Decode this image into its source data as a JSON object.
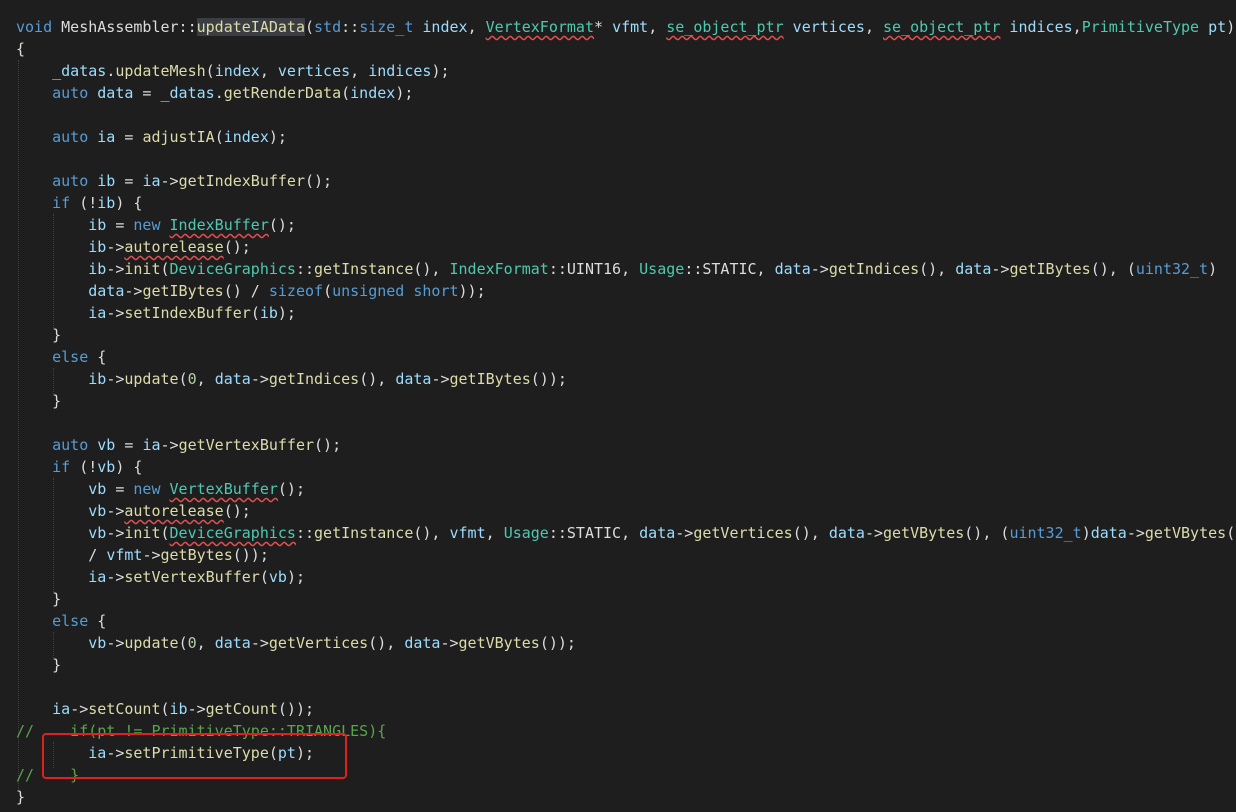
{
  "editor": {
    "highlighted_line": "ia->setPrimitiveType(pt);"
  },
  "lines": [
    [
      [
        "kw",
        "void "
      ],
      [
        "pl",
        "MeshAssembler::"
      ],
      [
        "fn sel",
        "updateIAData"
      ],
      [
        "pl",
        "("
      ],
      [
        "kw",
        "std"
      ],
      [
        "pl",
        "::"
      ],
      [
        "kw",
        "size_t "
      ],
      [
        "var",
        "index"
      ],
      [
        "pl",
        ", "
      ],
      [
        "cls err",
        "VertexFormat"
      ],
      [
        "pl",
        "* "
      ],
      [
        "var",
        "vfmt"
      ],
      [
        "pl",
        ", "
      ],
      [
        "cls err",
        "se_object_ptr"
      ],
      [
        "var",
        " vertices"
      ],
      [
        "pl",
        ", "
      ],
      [
        "cls err",
        "se_object_ptr"
      ],
      [
        "var",
        " indices"
      ],
      [
        "pl",
        ","
      ],
      [
        "cls",
        "PrimitiveType"
      ],
      [
        "var",
        " pt"
      ],
      [
        "pl",
        ")"
      ]
    ],
    [
      [
        "pl",
        "{"
      ]
    ],
    [
      [
        "pl",
        "    "
      ],
      [
        "var",
        "_datas"
      ],
      [
        "pl",
        "."
      ],
      [
        "fn",
        "updateMesh"
      ],
      [
        "pl",
        "("
      ],
      [
        "var",
        "index"
      ],
      [
        "pl",
        ", "
      ],
      [
        "var",
        "vertices"
      ],
      [
        "pl",
        ", "
      ],
      [
        "var",
        "indices"
      ],
      [
        "pl",
        ");"
      ]
    ],
    [
      [
        "pl",
        "    "
      ],
      [
        "kw",
        "auto "
      ],
      [
        "var",
        "data"
      ],
      [
        "pl",
        " = "
      ],
      [
        "var",
        "_datas"
      ],
      [
        "pl",
        "."
      ],
      [
        "fn",
        "getRenderData"
      ],
      [
        "pl",
        "("
      ],
      [
        "var",
        "index"
      ],
      [
        "pl",
        ");"
      ]
    ],
    [],
    [
      [
        "pl",
        "    "
      ],
      [
        "kw",
        "auto "
      ],
      [
        "var",
        "ia"
      ],
      [
        "pl",
        " = "
      ],
      [
        "fn",
        "adjustIA"
      ],
      [
        "pl",
        "("
      ],
      [
        "var",
        "index"
      ],
      [
        "pl",
        ");"
      ]
    ],
    [],
    [
      [
        "pl",
        "    "
      ],
      [
        "kw",
        "auto "
      ],
      [
        "var",
        "ib"
      ],
      [
        "pl",
        " = "
      ],
      [
        "var",
        "ia"
      ],
      [
        "pl",
        "->"
      ],
      [
        "fn",
        "getIndexBuffer"
      ],
      [
        "pl",
        "();"
      ]
    ],
    [
      [
        "pl",
        "    "
      ],
      [
        "kw",
        "if "
      ],
      [
        "pl",
        "(!"
      ],
      [
        "var",
        "ib"
      ],
      [
        "pl",
        ") {"
      ]
    ],
    [
      [
        "pl",
        "        "
      ],
      [
        "var",
        "ib"
      ],
      [
        "pl",
        " = "
      ],
      [
        "kw",
        "new "
      ],
      [
        "cls err",
        "IndexBuffer"
      ],
      [
        "pl",
        "();"
      ]
    ],
    [
      [
        "pl",
        "        "
      ],
      [
        "var",
        "ib"
      ],
      [
        "pl",
        "->"
      ],
      [
        "fn err",
        "autorelease"
      ],
      [
        "pl",
        "();"
      ]
    ],
    [
      [
        "pl",
        "        "
      ],
      [
        "var",
        "ib"
      ],
      [
        "pl",
        "->"
      ],
      [
        "fn",
        "init"
      ],
      [
        "pl",
        "("
      ],
      [
        "cls",
        "DeviceGraphics"
      ],
      [
        "pl",
        "::"
      ],
      [
        "fn",
        "getInstance"
      ],
      [
        "pl",
        "(), "
      ],
      [
        "cls",
        "IndexFormat"
      ],
      [
        "pl",
        "::UINT16, "
      ],
      [
        "cls",
        "Usage"
      ],
      [
        "pl",
        "::STATIC, "
      ],
      [
        "var",
        "data"
      ],
      [
        "pl",
        "->"
      ],
      [
        "fn",
        "getIndices"
      ],
      [
        "pl",
        "(), "
      ],
      [
        "var",
        "data"
      ],
      [
        "pl",
        "->"
      ],
      [
        "fn",
        "getIBytes"
      ],
      [
        "pl",
        "(), ("
      ],
      [
        "kw",
        "uint32_t"
      ],
      [
        "pl",
        ")"
      ]
    ],
    [
      [
        "pl",
        "        "
      ],
      [
        "var",
        "data"
      ],
      [
        "pl",
        "->"
      ],
      [
        "fn",
        "getIBytes"
      ],
      [
        "pl",
        "() / "
      ],
      [
        "kw",
        "sizeof"
      ],
      [
        "pl",
        "("
      ],
      [
        "kw",
        "unsigned short"
      ],
      [
        "pl",
        "));"
      ]
    ],
    [
      [
        "pl",
        "        "
      ],
      [
        "var",
        "ia"
      ],
      [
        "pl",
        "->"
      ],
      [
        "fn",
        "setIndexBuffer"
      ],
      [
        "pl",
        "("
      ],
      [
        "var",
        "ib"
      ],
      [
        "pl",
        ");"
      ]
    ],
    [
      [
        "pl",
        "    }"
      ]
    ],
    [
      [
        "pl",
        "    "
      ],
      [
        "kw",
        "else "
      ],
      [
        "pl",
        "{"
      ]
    ],
    [
      [
        "pl",
        "        "
      ],
      [
        "var",
        "ib"
      ],
      [
        "pl",
        "->"
      ],
      [
        "fn",
        "update"
      ],
      [
        "pl",
        "("
      ],
      [
        "num",
        "0"
      ],
      [
        "pl",
        ", "
      ],
      [
        "var",
        "data"
      ],
      [
        "pl",
        "->"
      ],
      [
        "fn",
        "getIndices"
      ],
      [
        "pl",
        "(), "
      ],
      [
        "var",
        "data"
      ],
      [
        "pl",
        "->"
      ],
      [
        "fn",
        "getIBytes"
      ],
      [
        "pl",
        "());"
      ]
    ],
    [
      [
        "pl",
        "    }"
      ]
    ],
    [],
    [
      [
        "pl",
        "    "
      ],
      [
        "kw",
        "auto "
      ],
      [
        "var",
        "vb"
      ],
      [
        "pl",
        " = "
      ],
      [
        "var",
        "ia"
      ],
      [
        "pl",
        "->"
      ],
      [
        "fn",
        "getVertexBuffer"
      ],
      [
        "pl",
        "();"
      ]
    ],
    [
      [
        "pl",
        "    "
      ],
      [
        "kw",
        "if "
      ],
      [
        "pl",
        "(!"
      ],
      [
        "var",
        "vb"
      ],
      [
        "pl",
        ") {"
      ]
    ],
    [
      [
        "pl",
        "        "
      ],
      [
        "var",
        "vb"
      ],
      [
        "pl",
        " = "
      ],
      [
        "kw",
        "new "
      ],
      [
        "cls err",
        "VertexBuffer"
      ],
      [
        "pl",
        "();"
      ]
    ],
    [
      [
        "pl",
        "        "
      ],
      [
        "var",
        "vb"
      ],
      [
        "pl",
        "->"
      ],
      [
        "fn err",
        "autorelease"
      ],
      [
        "pl",
        "();"
      ]
    ],
    [
      [
        "pl",
        "        "
      ],
      [
        "var",
        "vb"
      ],
      [
        "pl",
        "->"
      ],
      [
        "fn",
        "init"
      ],
      [
        "pl",
        "("
      ],
      [
        "cls err",
        "DeviceGraphics"
      ],
      [
        "pl",
        "::"
      ],
      [
        "fn",
        "getInstance"
      ],
      [
        "pl",
        "(), "
      ],
      [
        "var",
        "vfmt"
      ],
      [
        "pl",
        ", "
      ],
      [
        "cls",
        "Usage"
      ],
      [
        "pl",
        "::STATIC, "
      ],
      [
        "var",
        "data"
      ],
      [
        "pl",
        "->"
      ],
      [
        "fn",
        "getVertices"
      ],
      [
        "pl",
        "(), "
      ],
      [
        "var",
        "data"
      ],
      [
        "pl",
        "->"
      ],
      [
        "fn",
        "getVBytes"
      ],
      [
        "pl",
        "(), ("
      ],
      [
        "kw",
        "uint32_t"
      ],
      [
        "pl",
        ")"
      ],
      [
        "var",
        "data"
      ],
      [
        "pl",
        "->"
      ],
      [
        "fn",
        "getVBytes"
      ],
      [
        "pl",
        "()"
      ]
    ],
    [
      [
        "pl",
        "        / "
      ],
      [
        "var",
        "vfmt"
      ],
      [
        "pl",
        "->"
      ],
      [
        "fn",
        "getBytes"
      ],
      [
        "pl",
        "());"
      ]
    ],
    [
      [
        "pl",
        "        "
      ],
      [
        "var",
        "ia"
      ],
      [
        "pl",
        "->"
      ],
      [
        "fn",
        "setVertexBuffer"
      ],
      [
        "pl",
        "("
      ],
      [
        "var",
        "vb"
      ],
      [
        "pl",
        ");"
      ]
    ],
    [
      [
        "pl",
        "    }"
      ]
    ],
    [
      [
        "pl",
        "    "
      ],
      [
        "kw",
        "else "
      ],
      [
        "pl",
        "{"
      ]
    ],
    [
      [
        "pl",
        "        "
      ],
      [
        "var",
        "vb"
      ],
      [
        "pl",
        "->"
      ],
      [
        "fn",
        "update"
      ],
      [
        "pl",
        "("
      ],
      [
        "num",
        "0"
      ],
      [
        "pl",
        ", "
      ],
      [
        "var",
        "data"
      ],
      [
        "pl",
        "->"
      ],
      [
        "fn",
        "getVertices"
      ],
      [
        "pl",
        "(), "
      ],
      [
        "var",
        "data"
      ],
      [
        "pl",
        "->"
      ],
      [
        "fn",
        "getVBytes"
      ],
      [
        "pl",
        "());"
      ]
    ],
    [
      [
        "pl",
        "    }"
      ]
    ],
    [],
    [
      [
        "pl",
        "    "
      ],
      [
        "var",
        "ia"
      ],
      [
        "pl",
        "->"
      ],
      [
        "fn",
        "setCount"
      ],
      [
        "pl",
        "("
      ],
      [
        "var",
        "ib"
      ],
      [
        "pl",
        "->"
      ],
      [
        "fn",
        "getCount"
      ],
      [
        "pl",
        "());"
      ]
    ],
    [
      [
        "cm",
        "//    if(pt != PrimitiveType::TRIANGLES){"
      ]
    ],
    [
      [
        "pl",
        "        "
      ],
      [
        "var",
        "ia"
      ],
      [
        "pl",
        "->"
      ],
      [
        "fn",
        "setPrimitiveType"
      ],
      [
        "pl",
        "("
      ],
      [
        "var",
        "pt"
      ],
      [
        "pl",
        ");"
      ]
    ],
    [
      [
        "cm",
        "//    }"
      ]
    ],
    [
      [
        "pl",
        "}"
      ]
    ]
  ]
}
